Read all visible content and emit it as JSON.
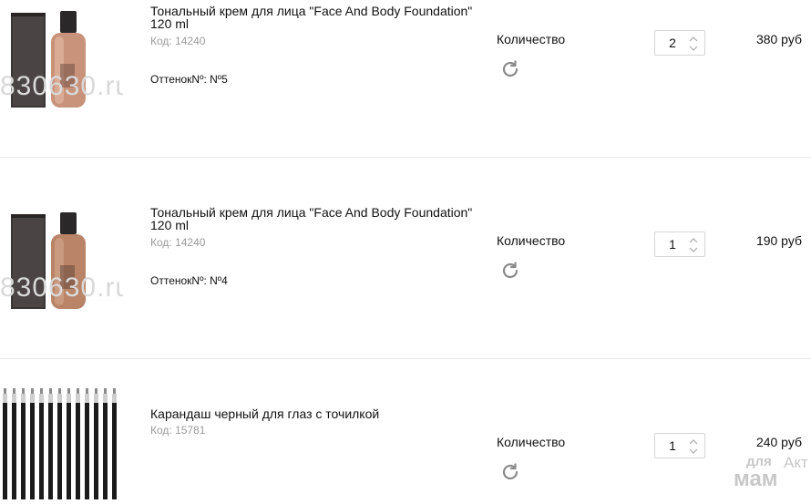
{
  "items": [
    {
      "title_line1": "Тональный крем для лица \"Face And Body Foundation\"",
      "title_line2": "120 ml",
      "code": "Код: 14240",
      "shade": "ОттенокNº: Nº5",
      "qty_label": "Количество",
      "quantity": "2",
      "price": "380 руб",
      "image_icon": "foundation-bottle-icon",
      "watermark": "830630.ru"
    },
    {
      "title_line1": "Тональный крем для лица \"Face And Body Foundation\"",
      "title_line2": "120 ml",
      "code": "Код: 14240",
      "shade": "ОттенокNº: Nº4",
      "qty_label": "Количество",
      "quantity": "1",
      "price": "190 руб",
      "image_icon": "foundation-bottle-icon",
      "watermark": "830630.ru"
    },
    {
      "title_line1": "Карандаш черный для глаз с точилкой",
      "code": "Код: 15781",
      "qty_label": "Количество",
      "quantity": "1",
      "price": "240 руб",
      "image_icon": "eye-pencils-icon"
    }
  ],
  "overlay": {
    "logo_text": "для мам",
    "side_text": "Акт"
  },
  "colors": {
    "separator": "#e6e6e6",
    "muted_text": "#9a9a9a",
    "border": "#d5d5d5",
    "icon_gray": "#8a8a8a"
  }
}
